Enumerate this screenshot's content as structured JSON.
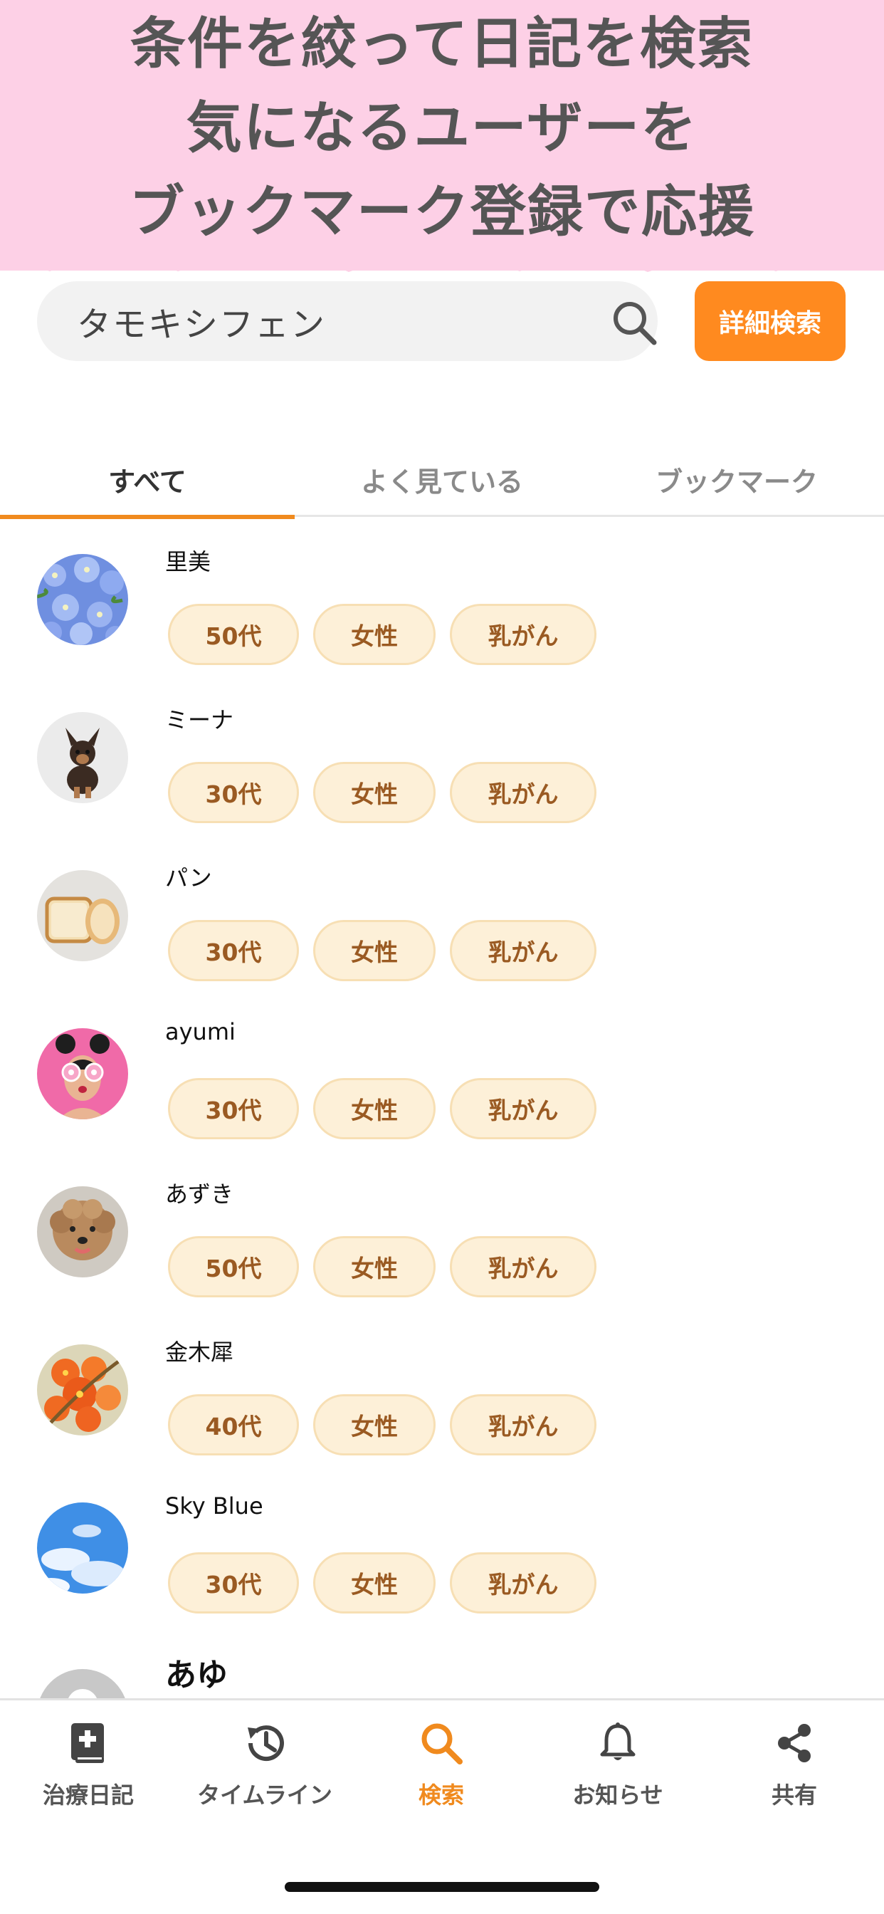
{
  "banner": {
    "line1": "条件を絞って日記を検索",
    "line2": "気になるユーザーを",
    "line3": "ブックマーク登録で応援"
  },
  "search": {
    "value": "タモキシフェン",
    "detail_button_label": "詳細検索"
  },
  "tabs": [
    {
      "label": "すべて",
      "active": true
    },
    {
      "label": "よく見ている",
      "active": false
    },
    {
      "label": "ブックマーク",
      "active": false
    }
  ],
  "users": [
    {
      "name": "里美",
      "age": "50代",
      "gender": "女性",
      "disease": "乳がん",
      "avatar": "blue-flowers"
    },
    {
      "name": "ミーナ",
      "age": "30代",
      "gender": "女性",
      "disease": "乳がん",
      "avatar": "chihuahua"
    },
    {
      "name": "パン",
      "age": "30代",
      "gender": "女性",
      "disease": "乳がん",
      "avatar": "bread"
    },
    {
      "name": "ayumi",
      "age": "30代",
      "gender": "女性",
      "disease": "乳がん",
      "avatar": "donut-girl"
    },
    {
      "name": "あずき",
      "age": "50代",
      "gender": "女性",
      "disease": "乳がん",
      "avatar": "poodle"
    },
    {
      "name": "金木犀",
      "age": "40代",
      "gender": "女性",
      "disease": "乳がん",
      "avatar": "orange-flowers"
    },
    {
      "name": "Sky Blue",
      "age": "30代",
      "gender": "女性",
      "disease": "乳がん",
      "avatar": "blue-sky"
    },
    {
      "name": "あゆ",
      "avatar": "default-avatar"
    }
  ],
  "bottom_nav": [
    {
      "label": "治療日記",
      "icon": "diary-icon",
      "active": false
    },
    {
      "label": "タイムライン",
      "icon": "history-icon",
      "active": false
    },
    {
      "label": "検索",
      "icon": "search-icon",
      "active": true
    },
    {
      "label": "お知らせ",
      "icon": "bell-icon",
      "active": false
    },
    {
      "label": "共有",
      "icon": "share-icon",
      "active": false
    }
  ],
  "colors": {
    "accent": "#f08a1e",
    "button": "#ff8a1f",
    "banner_bg": "#fdd0e6",
    "tag_bg": "#fdf0d8",
    "tag_text": "#9a5a22"
  }
}
